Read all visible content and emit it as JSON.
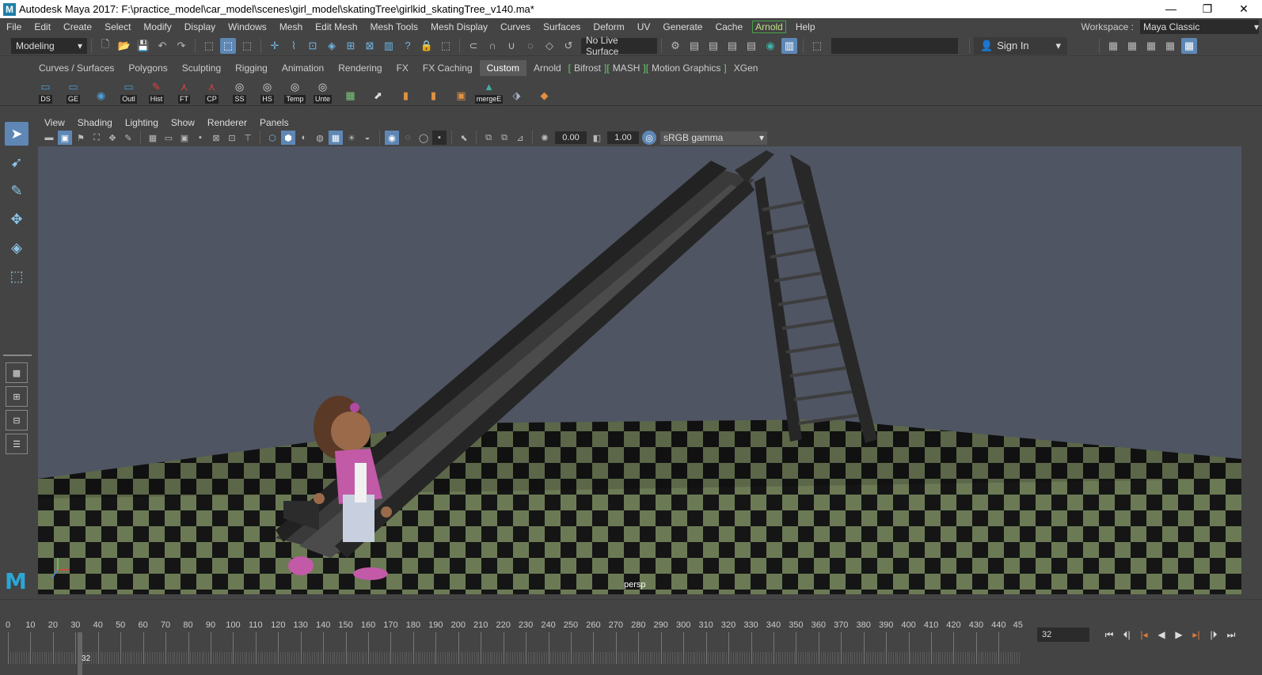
{
  "window": {
    "title": "Autodesk Maya 2017: F:\\practice_model\\car_model\\scenes\\girl_model\\skatingTree\\girlkid_skatingTree_v140.ma*",
    "logo_glyph": "M",
    "controls": [
      "—",
      "❐",
      "✕"
    ]
  },
  "menubar": {
    "items": [
      "File",
      "Edit",
      "Create",
      "Select",
      "Modify",
      "Display",
      "Windows",
      "Mesh",
      "Edit Mesh",
      "Mesh Tools",
      "Mesh Display",
      "Curves",
      "Surfaces",
      "Deform",
      "UV",
      "Generate",
      "Cache"
    ],
    "arnold": "Arnold",
    "help": "Help",
    "workspace_label": "Workspace :",
    "workspace_value": "Maya Classic"
  },
  "statusline": {
    "mode": "Modeling",
    "live_surface": "No Live Surface",
    "sign_in": "Sign In"
  },
  "shelf": {
    "tabs": [
      "Curves / Surfaces",
      "Polygons",
      "Sculpting",
      "Rigging",
      "Animation",
      "Rendering",
      "FX",
      "FX Caching",
      "Custom",
      "Arnold"
    ],
    "active_tab": "Custom",
    "bracket_tabs": [
      "Bifrost",
      "MASH",
      "Motion Graphics"
    ],
    "last_tab": "XGen",
    "buttons": [
      {
        "label": "DS",
        "icon": "▭",
        "color": "#4a9ed8"
      },
      {
        "label": "GE",
        "icon": "▭",
        "color": "#4a9ed8"
      },
      {
        "label": "",
        "icon": "◉",
        "color": "#4a9ed8"
      },
      {
        "label": "Outl",
        "icon": "▭",
        "color": "#4a9ed8"
      },
      {
        "label": "Hist",
        "icon": "✎",
        "color": "#e04040"
      },
      {
        "label": "FT",
        "icon": "⋏",
        "color": "#e04040"
      },
      {
        "label": "CP",
        "icon": "⋏",
        "color": "#e04040"
      },
      {
        "label": "SS",
        "icon": "◎",
        "color": "#dddddd"
      },
      {
        "label": "HS",
        "icon": "◎",
        "color": "#dddddd"
      },
      {
        "label": "Temp",
        "icon": "◎",
        "color": "#dddddd"
      },
      {
        "label": "Unte",
        "icon": "◎",
        "color": "#dddddd"
      },
      {
        "label": "",
        "icon": "▦",
        "color": "#7bc97b"
      },
      {
        "label": "",
        "icon": "⬈",
        "color": "#dddddd"
      },
      {
        "label": "",
        "icon": "▮",
        "color": "#e09040"
      },
      {
        "label": "",
        "icon": "▮",
        "color": "#e09040"
      },
      {
        "label": "",
        "icon": "▣",
        "color": "#e09040"
      },
      {
        "label": "mergeE",
        "icon": "▲",
        "color": "#3fb0a8"
      },
      {
        "label": "",
        "icon": "⬗",
        "color": "#aab4d0"
      },
      {
        "label": "",
        "icon": "◆",
        "color": "#e09040"
      }
    ]
  },
  "panel": {
    "menus": [
      "View",
      "Shading",
      "Lighting",
      "Show",
      "Renderer",
      "Panels"
    ],
    "exposure": "0.00",
    "gamma": "1.00",
    "colorspace": "sRGB gamma",
    "camera": "persp"
  },
  "timeline": {
    "ticks": [
      0,
      10,
      20,
      30,
      40,
      50,
      60,
      70,
      80,
      90,
      100,
      110,
      120,
      130,
      140,
      150,
      160,
      170,
      180,
      190,
      200,
      210,
      220,
      230,
      240,
      250,
      260,
      270,
      280,
      290,
      300,
      310,
      320,
      330,
      340,
      350,
      360,
      370,
      380,
      390,
      400,
      410,
      420,
      430,
      440
    ],
    "last_tick_partial": "45",
    "current_frame": "32",
    "frame_field": "32"
  },
  "colors": {
    "active_blue": "#5e87b5",
    "arnold_green": "#47a447",
    "playhead": "#666666"
  }
}
